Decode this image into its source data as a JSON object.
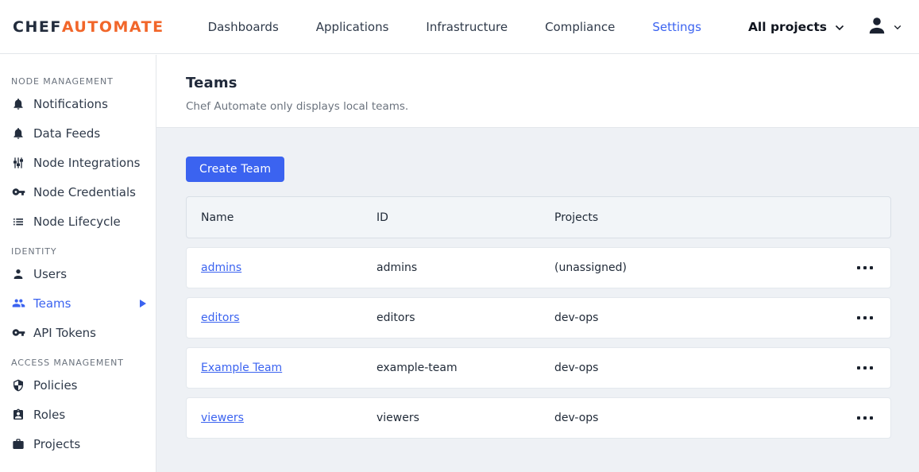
{
  "colors": {
    "blue": "#3b63f0",
    "orange": "#f1662a",
    "dark": "#222c3c",
    "page_bg": "#eef1f5"
  },
  "header": {
    "logo": {
      "chef": "CHEF",
      "automate": "AUTOMATE"
    },
    "nav": [
      {
        "label": "Dashboards",
        "active": false
      },
      {
        "label": "Applications",
        "active": false
      },
      {
        "label": "Infrastructure",
        "active": false
      },
      {
        "label": "Compliance",
        "active": false
      },
      {
        "label": "Settings",
        "active": true
      }
    ],
    "projects_dropdown": {
      "label": "All projects",
      "icon": "chevron-down-icon"
    },
    "user_menu": {
      "icon": "person-icon",
      "chevron": "chevron-down-icon"
    }
  },
  "sidebar": {
    "sections": [
      {
        "label": "NODE MANAGEMENT",
        "items": [
          {
            "label": "Notifications",
            "icon": "bell-icon"
          },
          {
            "label": "Data Feeds",
            "icon": "bell-icon"
          },
          {
            "label": "Node Integrations",
            "icon": "sliders-icon"
          },
          {
            "label": "Node Credentials",
            "icon": "key-icon"
          },
          {
            "label": "Node Lifecycle",
            "icon": "list-icon"
          }
        ]
      },
      {
        "label": "IDENTITY",
        "items": [
          {
            "label": "Users",
            "icon": "person-icon"
          },
          {
            "label": "Teams",
            "icon": "teams-icon",
            "active": true,
            "expander": "triangle-right-icon"
          },
          {
            "label": "API Tokens",
            "icon": "key-icon"
          }
        ]
      },
      {
        "label": "ACCESS MANAGEMENT",
        "items": [
          {
            "label": "Policies",
            "icon": "shield-icon"
          },
          {
            "label": "Roles",
            "icon": "badge-icon"
          },
          {
            "label": "Projects",
            "icon": "briefcase-icon"
          }
        ]
      }
    ]
  },
  "main": {
    "title": "Teams",
    "subtitle": "Chef Automate only displays local teams.",
    "create_button": "Create Team",
    "table": {
      "columns": [
        "Name",
        "ID",
        "Projects"
      ],
      "row_menu_icon": "ellipsis-icon",
      "rows": [
        {
          "name": "admins",
          "id": "admins",
          "projects": "(unassigned)"
        },
        {
          "name": "editors",
          "id": "editors",
          "projects": "dev-ops"
        },
        {
          "name": "Example Team",
          "id": "example-team",
          "projects": "dev-ops"
        },
        {
          "name": "viewers",
          "id": "viewers",
          "projects": "dev-ops"
        }
      ]
    }
  }
}
